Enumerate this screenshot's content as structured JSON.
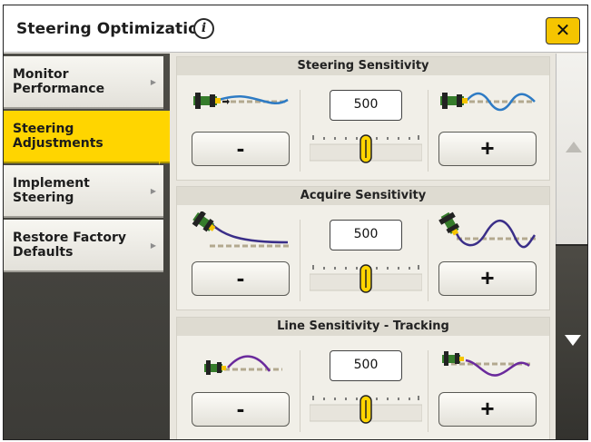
{
  "header": {
    "title": "Steering Optimization",
    "info_glyph": "i",
    "close_glyph": "✕"
  },
  "sidebar": {
    "items": [
      {
        "label": "Monitor Performance",
        "selected": false
      },
      {
        "label": "Steering Adjustments",
        "selected": true
      },
      {
        "label": "Implement Steering",
        "selected": false
      },
      {
        "label": "Restore Factory Defaults",
        "selected": false
      }
    ],
    "arrow_glyph": "▶"
  },
  "panels": [
    {
      "title": "Steering Sensitivity",
      "value": "500",
      "slider_level": 0.5,
      "minus": "-",
      "plus": "+"
    },
    {
      "title": "Acquire Sensitivity",
      "value": "500",
      "slider_level": 0.5,
      "minus": "-",
      "plus": "+"
    },
    {
      "title": "Line Sensitivity - Tracking",
      "value": "500",
      "slider_level": 0.5,
      "minus": "-",
      "plus": "+"
    }
  ],
  "colors": {
    "accent_yellow": "#ffd500",
    "tractor_green": "#367c2b",
    "line_blue": "#2e7bc4",
    "curve_purple": "#6a2a9c",
    "dark_panel": "#3c3b37"
  },
  "icons": {
    "info": "info-icon",
    "close": "close-icon",
    "scroll_up": "triangle-up-icon",
    "scroll_down": "triangle-down-icon"
  }
}
